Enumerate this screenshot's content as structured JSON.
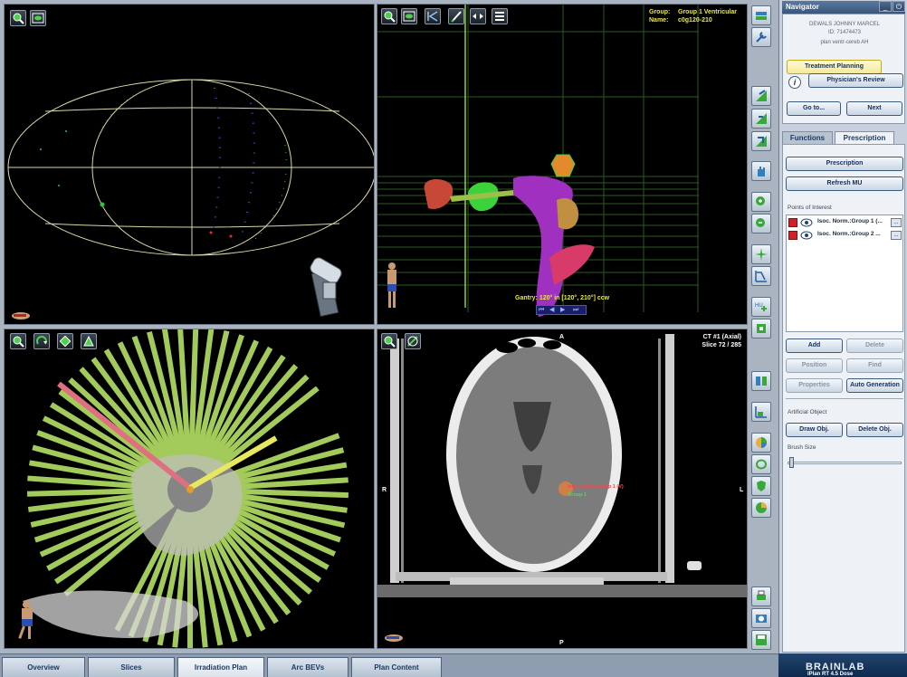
{
  "viewports": {
    "top_right": {
      "group_label": "Group:",
      "group_value": "Group 1 Ventricular",
      "name_label": "Name:",
      "name_value": "c0g120-210",
      "gantry_text": "Gantry: 120° in [120°, 210°] ccw"
    },
    "bottom_right": {
      "ct_title": "CT #1 (Axial)",
      "slice_text": "Slice 72 / 285",
      "orient_anterior": "A",
      "orient_posterior": "P",
      "orient_right": "R",
      "orient_left": "L",
      "poi_annotation": "Isoc. Norm.(Group 1 (V)",
      "poi_annotation_2": "Group 1"
    }
  },
  "navigator": {
    "title": "Navigator",
    "minimize_label": "_",
    "power_icon": "power-icon",
    "patient_name": "DEWALS JOHNNY MARCEL",
    "patient_id": "ID: 71474473",
    "plan_name": "plan ventr-cereb AH",
    "treatment_planning_label": "Treatment Planning",
    "physicians_review_label": "Physician's Review",
    "goto_label": "Go to...",
    "next_label": "Next"
  },
  "function_tabs": {
    "functions_label": "Functions",
    "prescription_label": "Prescription",
    "selected": "Prescription"
  },
  "prescription_panel": {
    "prescription_button": "Prescription",
    "refresh_mu_button": "Refresh MU",
    "points_of_interest_label": "Points of Interest",
    "poi_items": [
      {
        "label": "Isoc. Norm.:Group 1 (...",
        "more": "...",
        "color": "#d0202a"
      },
      {
        "label": "Isoc. Norm.:Group 2 ...",
        "more": "...",
        "color": "#d0202a"
      }
    ],
    "add_button": "Add",
    "delete_button": "Delete",
    "position_button": "Position",
    "find_button": "Find",
    "properties_button": "Properties",
    "auto_generation_button": "Auto Generation",
    "artificial_object_label": "Artificial Object",
    "draw_obj_button": "Draw Obj.",
    "delete_obj_button": "Delete Obj.",
    "brush_size_label": "Brush Size"
  },
  "bottom_tabs": [
    {
      "label": "Overview"
    },
    {
      "label": "Slices"
    },
    {
      "label": "Irradiation Plan"
    },
    {
      "label": "Arc BEVs"
    },
    {
      "label": "Plan Content"
    }
  ],
  "selected_bottom_tab": "Irradiation Plan",
  "branding": {
    "company": "BRAINLAB",
    "product": "iPlan RT 4.5 Dose"
  },
  "colors": {
    "accent_yellow": "#e8e845",
    "panel_bg": "#c7d0dc",
    "nav_head": "#3a5579",
    "poi_red": "#d0202a"
  }
}
